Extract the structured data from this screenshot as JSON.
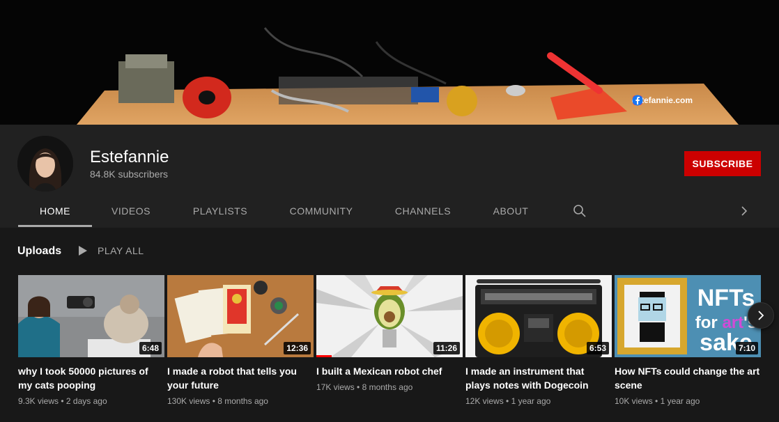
{
  "banner": {
    "site_link": "estefannie.com",
    "social": [
      "instagram-icon",
      "twitter-icon",
      "facebook-icon"
    ]
  },
  "channel": {
    "name": "Estefannie",
    "subscribers": "84.8K subscribers",
    "subscribe_label": "SUBSCRIBE"
  },
  "tabs": [
    "HOME",
    "VIDEOS",
    "PLAYLISTS",
    "COMMUNITY",
    "CHANNELS",
    "ABOUT"
  ],
  "active_tab": "HOME",
  "uploads": {
    "title": "Uploads",
    "play_all": "PLAY ALL",
    "videos": [
      {
        "title": "why I took 50000 pictures of my cats pooping",
        "views": "9.3K views",
        "age": "2 days ago",
        "duration": "6:48"
      },
      {
        "title": "I made a robot that tells you your future",
        "views": "130K views",
        "age": "8 months ago",
        "duration": "12:36"
      },
      {
        "title": "I built a Mexican robot chef",
        "views": "17K views",
        "age": "8 months ago",
        "duration": "11:26"
      },
      {
        "title": "I made an instrument that plays notes with Dogecoin",
        "views": "12K views",
        "age": "1 year ago",
        "duration": "6:53"
      },
      {
        "title": "How NFTs could change the art scene",
        "views": "10K views",
        "age": "1 year ago",
        "duration": "7:10"
      }
    ]
  },
  "thumb5_text": {
    "line1": "NFTs",
    "line2a": "for ",
    "line2b": "art",
    "line2c": "'s",
    "line3": "sake"
  },
  "colors": {
    "subscribe": "#cc0000",
    "background": "#181818",
    "header": "#212121",
    "progress": "#ff0000"
  }
}
